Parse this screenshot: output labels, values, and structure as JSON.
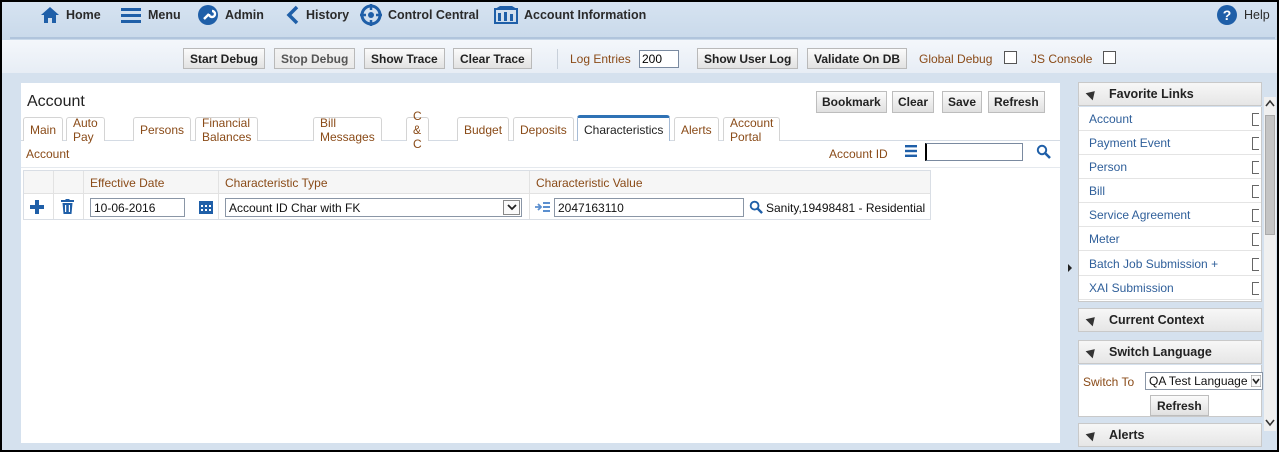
{
  "nav": {
    "home": "Home",
    "menu": "Menu",
    "admin": "Admin",
    "history": "History",
    "control_central": "Control Central",
    "account_information": "Account Information",
    "help": "Help"
  },
  "debug": {
    "start_debug": "Start Debug",
    "stop_debug": "Stop Debug",
    "show_trace": "Show Trace",
    "clear_trace": "Clear Trace",
    "log_entries_label": "Log Entries",
    "log_entries_value": "200",
    "show_user_log": "Show User Log",
    "validate_on_db": "Validate On DB",
    "global_debug_label": "Global Debug",
    "js_console_label": "JS Console"
  },
  "main": {
    "title": "Account",
    "buttons": {
      "bookmark": "Bookmark",
      "clear": "Clear",
      "save": "Save",
      "refresh": "Refresh"
    },
    "tabs": [
      {
        "label": "Main"
      },
      {
        "label": "Auto Pay"
      },
      {
        "label": "Persons"
      },
      {
        "label": "Financial Balances"
      },
      {
        "label": "Bill Messages"
      },
      {
        "label": "C & C"
      },
      {
        "label": "Budget"
      },
      {
        "label": "Deposits"
      },
      {
        "label": "Characteristics"
      },
      {
        "label": "Alerts"
      },
      {
        "label": "Account Portal"
      }
    ],
    "active_tab": "Characteristics",
    "subheader_left": "Account",
    "account_id_label": "Account ID",
    "account_id_value": "",
    "grid": {
      "headers": [
        "Effective Date",
        "Characteristic Type",
        "Characteristic Value"
      ],
      "rows": [
        {
          "effective_date": "10-06-2016",
          "characteristic_type": "Account ID Char with FK",
          "characteristic_value": "2047163110",
          "description": "Sanity,19498481 - Residential"
        }
      ]
    }
  },
  "sidebar": {
    "favorite_links_title": "Favorite Links",
    "favorite_links": [
      {
        "label": "Account"
      },
      {
        "label": "Payment Event"
      },
      {
        "label": "Person"
      },
      {
        "label": "Bill"
      },
      {
        "label": "Service Agreement"
      },
      {
        "label": "Meter"
      },
      {
        "label": "Batch Job Submission +"
      },
      {
        "label": "XAI Submission"
      }
    ],
    "current_context_title": "Current Context",
    "switch_language_title": "Switch Language",
    "switch_to_label": "Switch To",
    "switch_to_value": "QA Test Language",
    "refresh_label": "Refresh",
    "alerts_title": "Alerts"
  },
  "colors": {
    "accent_blue": "#2f72b5",
    "label_brown": "#8a4b18",
    "link_blue": "#2f5f9a"
  }
}
